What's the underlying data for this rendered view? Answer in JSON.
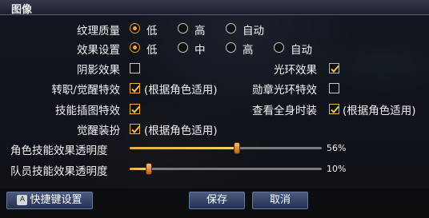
{
  "title": "图像",
  "texture_quality": {
    "label": "纹理质量",
    "options": [
      "低",
      "高",
      "自动"
    ],
    "selected": 0
  },
  "effect_settings": {
    "label": "效果设置",
    "options": [
      "低",
      "中",
      "高",
      "自动"
    ],
    "selected": 0
  },
  "shadow_effect": {
    "label": "阴影效果",
    "checked": false
  },
  "halo_effect": {
    "label": "光环效果",
    "checked": true
  },
  "job_awaken_effect": {
    "label": "转职/觉醒特效",
    "checked": true,
    "note": "(根据角色适用)"
  },
  "medal_halo_effect": {
    "label": "勋章光环特效",
    "checked": false
  },
  "skill_illustration_effect": {
    "label": "技能插图特效",
    "checked": true
  },
  "view_full_fashion": {
    "label": "查看全身时装",
    "checked": true,
    "note": "(根据角色适用)"
  },
  "awaken_outfit": {
    "label": "觉醒装扮",
    "checked": true,
    "note": "(根据角色适用)"
  },
  "character_skill_transparency": {
    "label": "角色技能效果透明度",
    "value": 56,
    "display": "56%"
  },
  "member_skill_transparency": {
    "label": "队员技能效果透明度",
    "value": 10,
    "display": "10%"
  },
  "buttons": {
    "hotkey_badge": "A",
    "hotkey": "快捷键设置",
    "save": "保存",
    "cancel": "取消"
  },
  "colors": {
    "accent": "#f3a43a",
    "button_bg": "#2e3b60"
  }
}
